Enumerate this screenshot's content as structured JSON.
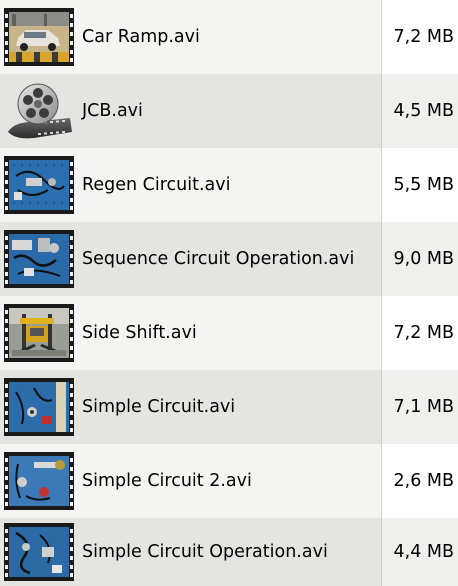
{
  "files": [
    {
      "name": "Car Ramp.avi",
      "size": "7,2 MB",
      "icon": "video-thumbnail-car-ramp-icon"
    },
    {
      "name": "JCB.avi",
      "size": "4,5 MB",
      "icon": "film-reel-icon"
    },
    {
      "name": "Regen Circuit.avi",
      "size": "5,5 MB",
      "icon": "video-thumbnail-circuit-icon"
    },
    {
      "name": "Sequence Circuit Operation.avi",
      "size": "9,0 MB",
      "icon": "video-thumbnail-circuit-icon"
    },
    {
      "name": "Side Shift.avi",
      "size": "7,2 MB",
      "icon": "video-thumbnail-forklift-icon"
    },
    {
      "name": "Simple Circuit.avi",
      "size": "7,1 MB",
      "icon": "video-thumbnail-circuit-icon"
    },
    {
      "name": "Simple Circuit 2.avi",
      "size": "2,6 MB",
      "icon": "video-thumbnail-circuit-icon"
    },
    {
      "name": "Simple Circuit Operation.avi",
      "size": "4,4 MB",
      "icon": "video-thumbnail-circuit-icon"
    }
  ]
}
